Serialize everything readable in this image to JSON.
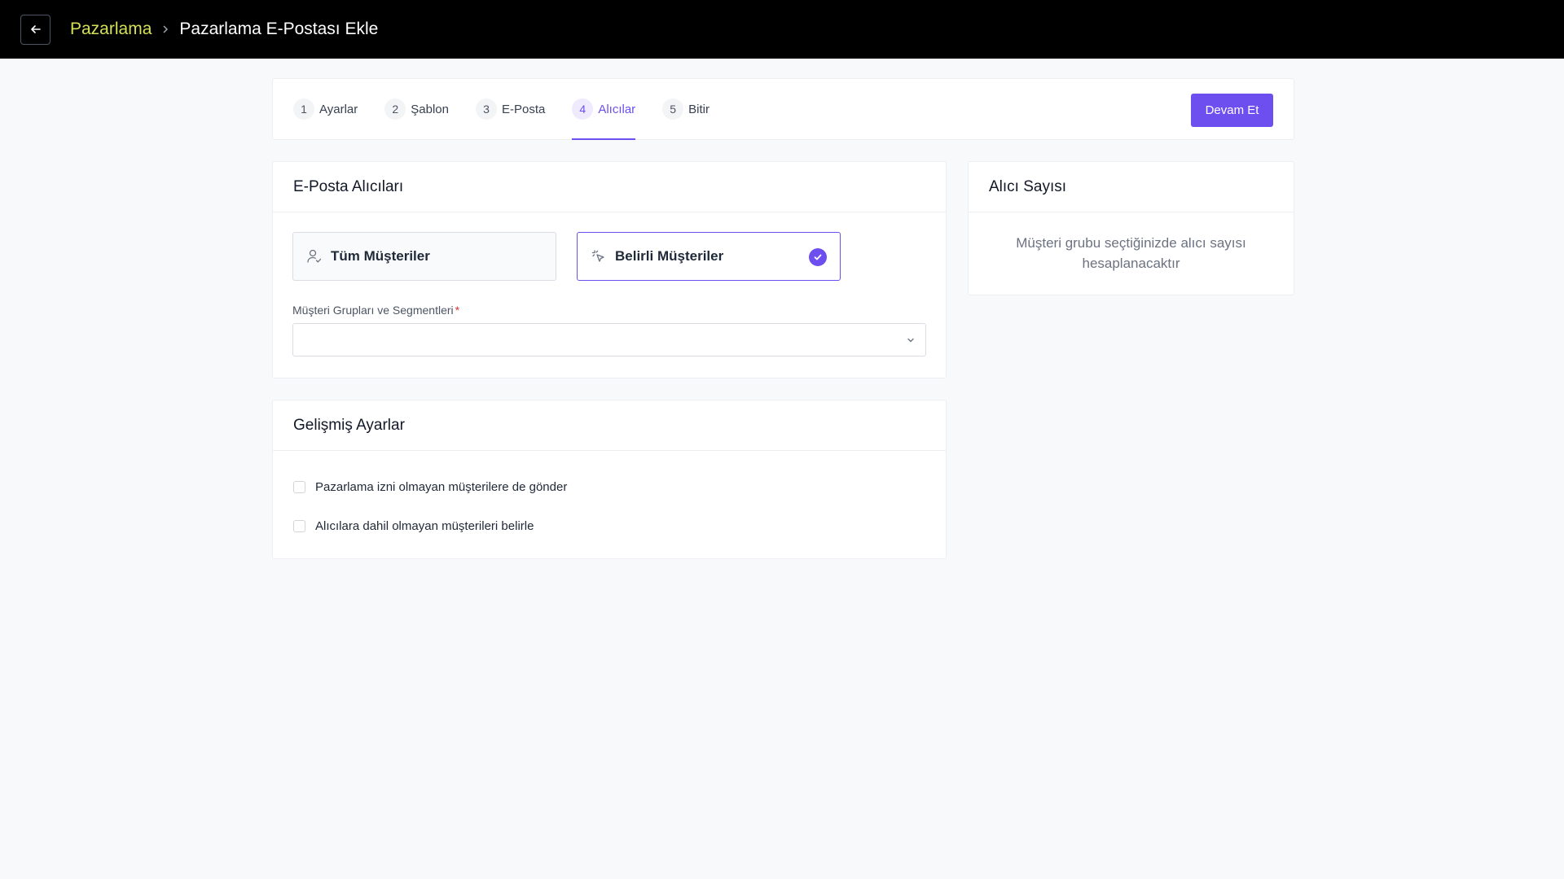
{
  "topbar": {
    "back_icon": "arrow-left-icon",
    "breadcrumb_root": "Pazarlama",
    "breadcrumb_current": "Pazarlama E-Postası Ekle",
    "breadcrumb_color": "#d4e157"
  },
  "stepper": {
    "steps": [
      {
        "num": "1",
        "label": "Ayarlar"
      },
      {
        "num": "2",
        "label": "Şablon"
      },
      {
        "num": "3",
        "label": "E-Posta"
      },
      {
        "num": "4",
        "label": "Alıcılar",
        "active": true
      },
      {
        "num": "5",
        "label": "Bitir"
      }
    ],
    "continue_label": "Devam Et",
    "accent": "#6d4ff0"
  },
  "recipients": {
    "title": "E-Posta Alıcıları",
    "options": [
      {
        "label": "Tüm Müşteriler",
        "icon": "user-check-icon",
        "selected": false
      },
      {
        "label": "Belirli Müşteriler",
        "icon": "sparkle-pointer-icon",
        "selected": true
      }
    ],
    "group_field_label": "Müşteri Grupları ve Segmentleri",
    "group_field_required": "*",
    "group_field_value": ""
  },
  "advanced": {
    "title": "Gelişmiş Ayarlar",
    "options": [
      {
        "label": "Pazarlama izni olmayan müşterilere de gönder",
        "checked": false
      },
      {
        "label": "Alıcılara dahil olmayan müşterileri belirle",
        "checked": false
      }
    ]
  },
  "count": {
    "title": "Alıcı Sayısı",
    "message": "Müşteri grubu seçtiğinizde alıcı sayısı hesaplanacaktır"
  }
}
